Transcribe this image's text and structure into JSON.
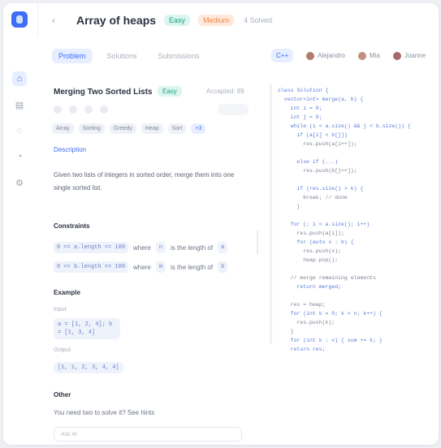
{
  "header": {
    "title": "Array of heaps",
    "difficulty": "Easy",
    "status": "Medium",
    "solved": "4 Solved"
  },
  "left_tabs": [
    "Problem",
    "Solutions",
    "Submissions"
  ],
  "problem": {
    "title": "Merging Two Sorted Lists",
    "badge": "Easy",
    "acceptance": "Accepted: 89",
    "tags": [
      "Array",
      "Sorting",
      "Greedy",
      "Heap",
      "Sort",
      "+3"
    ],
    "description_link": "Description",
    "description": "Given two lists of integers in sorted order, merge them into one single sorted list.",
    "constraints_label": "Constraints",
    "constraints": [
      {
        "code": "0 <= a.length <= 100",
        "text": "where",
        "chip2": "n",
        "text2": "is the length of",
        "chip3": "a"
      },
      {
        "code": "0 <= b.length <= 100",
        "text": "where",
        "chip2": "m",
        "text2": "is the length of",
        "chip3": "b"
      }
    ],
    "example_label": "Example",
    "input_label": "Input",
    "input_value": "a = [1, 2, 4]; b = [1, 3, 4]",
    "output_label": "Output",
    "output_value": "[1, 1, 2, 3, 4, 4]",
    "other_label": "Other",
    "other_note": "You need two to solve it? See hints",
    "input_placeholder": "Ask AI"
  },
  "editor": {
    "language": "C++",
    "users": [
      "Alejandro",
      "Mia",
      "Joanne"
    ],
    "code_lines": [
      "class Solution {",
      "  vector<int> merge(a, b) {",
      "    int i = 0;",
      "    int j = 0;",
      "    while (i < a.size() && j < b.size()) {",
      "      if (a[i] < b[j])",
      "        res.push(a[i++]);",
      "",
      "      else if (...)",
      "        res.push(b[j++]);",
      "",
      "      if (res.size() > k) {",
      "        break; // done",
      "      }",
      "",
      "    for (; i < a.size(); i++)",
      "      res.push(a[i]);",
      "      for (auto x : b) {",
      "        res.push(x);",
      "        heap.pop();",
      "",
      "    // merge remaining elements",
      "      return merged;",
      "",
      "    res = heap;",
      "    for (int k = 0; k < n; k++) {",
      "      res.push(k);",
      "    }",
      "    for (int k : v) { sum += k; }",
      "    return res;"
    ]
  }
}
